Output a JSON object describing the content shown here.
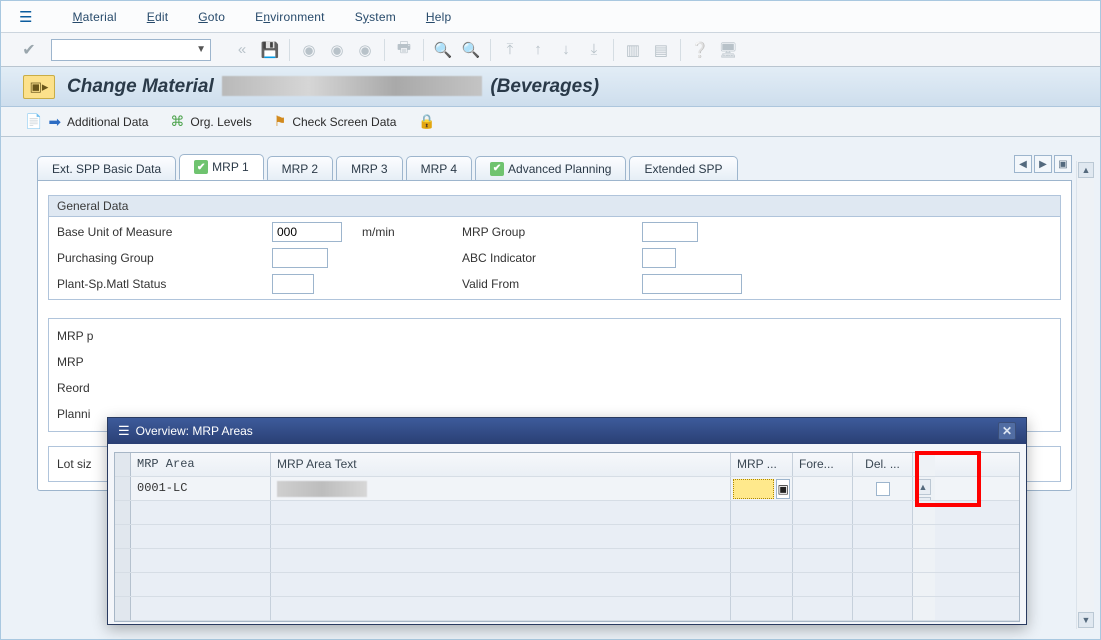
{
  "menu": {
    "items": [
      "Material",
      "Edit",
      "Goto",
      "Environment",
      "System",
      "Help"
    ],
    "accel": [
      "M",
      "E",
      "G",
      "n",
      "y",
      "H"
    ]
  },
  "title": {
    "prefix": "Change Material ",
    "suffix": " (Beverages)"
  },
  "subtoolbar": {
    "additional_data": "Additional Data",
    "org_levels": "Org. Levels",
    "check_screen": "Check Screen Data"
  },
  "tabs": {
    "ext_spp": "Ext. SPP Basic Data",
    "mrp1": "MRP 1",
    "mrp2": "MRP 2",
    "mrp3": "MRP 3",
    "mrp4": "MRP 4",
    "adv_plan": "Advanced Planning",
    "ext_spp2": "Extended SPP"
  },
  "general_data": {
    "section": "General Data",
    "buom_label": "Base Unit of Measure",
    "buom_value": "000",
    "buom_text": "m/min",
    "mrp_group_label": "MRP Group",
    "purch_group_label": "Purchasing Group",
    "abc_label": "ABC Indicator",
    "plant_status_label": "Plant-Sp.Matl Status",
    "valid_from_label": "Valid From"
  },
  "sections_truncated": {
    "mrp_p": "MRP p",
    "mrp_t": "MRP ",
    "reord": "Reord",
    "plann": "Planni",
    "lot": "Lot siz"
  },
  "modal": {
    "title": "Overview: MRP Areas",
    "cols": {
      "area": "MRP Area",
      "text": "MRP Area Text",
      "mrp": "MRP ...",
      "fore": "Fore...",
      "del": "Del. ..."
    },
    "rows": [
      {
        "area": "0001-LC",
        "text": ""
      }
    ]
  },
  "icons": {
    "menu": "☰",
    "combo_arrow": "▼",
    "nav_left": "◀",
    "nav_right": "▶",
    "nav_end": "▣",
    "chevron_back": "«",
    "check_circle": "✔",
    "save": "💾",
    "close": "✕",
    "picker": "▢",
    "arrow_up": "▲",
    "arrow_down": "▼",
    "lock": "🔒"
  }
}
